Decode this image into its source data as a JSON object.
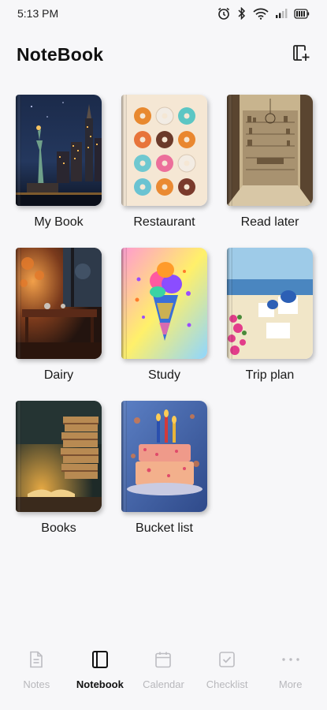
{
  "status_bar": {
    "time": "5:13 PM"
  },
  "header": {
    "title": "NoteBook"
  },
  "notebooks": [
    {
      "label": "My Book"
    },
    {
      "label": "Restaurant"
    },
    {
      "label": "Read later"
    },
    {
      "label": "Dairy"
    },
    {
      "label": "Study"
    },
    {
      "label": "Trip plan"
    },
    {
      "label": "Books"
    },
    {
      "label": "Bucket list"
    }
  ],
  "nav": [
    {
      "label": "Notes",
      "icon": "document-icon",
      "active": false
    },
    {
      "label": "Notebook",
      "icon": "notebook-icon",
      "active": true
    },
    {
      "label": "Calendar",
      "icon": "calendar-icon",
      "active": false
    },
    {
      "label": "Checklist",
      "icon": "checklist-icon",
      "active": false
    },
    {
      "label": "More",
      "icon": "more-dots-icon",
      "active": false
    }
  ],
  "colors": {
    "background": "#f7f7f9",
    "active_nav": "#111111",
    "inactive_nav": "#b8b8bc"
  }
}
